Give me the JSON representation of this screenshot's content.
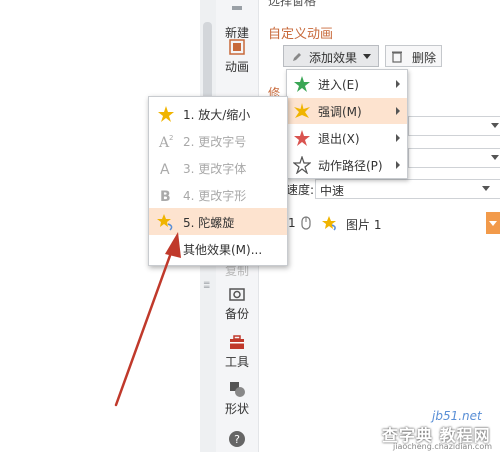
{
  "nav": {
    "items": [
      {
        "label": "新建",
        "icon": "new-icon"
      },
      {
        "label": "动画",
        "icon": "animation-icon"
      },
      {
        "label": "复制",
        "icon": "copy-icon"
      },
      {
        "label": "备份",
        "icon": "backup-icon"
      },
      {
        "label": "工具",
        "icon": "toolbox-icon"
      },
      {
        "label": "形状",
        "icon": "shapes-icon"
      },
      {
        "label": "",
        "icon": "help-icon"
      }
    ]
  },
  "panel": {
    "top_cut_text": "选择窗格",
    "custom_animation_title": "自定义动画",
    "add_effect_label": "添加效果",
    "delete_label": "删除",
    "modify_label": "修",
    "speed_label": "速度:",
    "speed_value": "中速",
    "list_row_index": "1",
    "list_row_label": "图片 1"
  },
  "menu_effect_types": [
    {
      "label": "进入(E)",
      "icon": "enter-star-icon"
    },
    {
      "label": "强调(M)",
      "icon": "emphasis-star-icon"
    },
    {
      "label": "退出(X)",
      "icon": "exit-star-icon"
    },
    {
      "label": "动作路径(P)",
      "icon": "motion-path-icon"
    }
  ],
  "menu_emphasis": [
    {
      "label": "1. 放大/缩小",
      "icon": "grow-shrink-icon",
      "enabled": true
    },
    {
      "label": "2. 更改字号",
      "icon": "font-size-icon",
      "enabled": false
    },
    {
      "label": "3. 更改字体",
      "icon": "font-icon",
      "enabled": false
    },
    {
      "label": "4. 更改字形",
      "icon": "font-style-icon",
      "enabled": false
    },
    {
      "label": "5. 陀螺旋",
      "icon": "spin-icon",
      "enabled": true,
      "highlighted": true
    },
    {
      "label": "其他效果(M)...",
      "icon": "",
      "enabled": true
    }
  ],
  "watermark": {
    "line1": "jb51.net",
    "line2": "查字典 教程网",
    "line3": "jiaocheng.chazidian.com"
  },
  "colors": {
    "accent_orange": "#c8693a",
    "highlight": "#fde3cf",
    "annotation_arrow": "#c0392b"
  }
}
